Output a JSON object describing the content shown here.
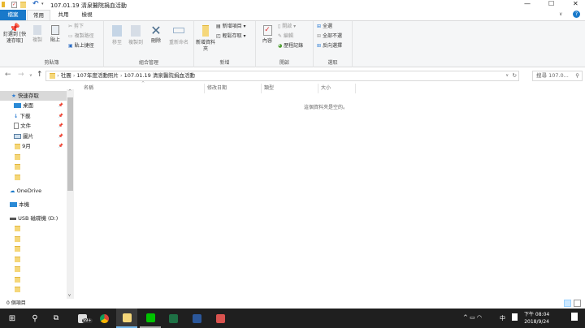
{
  "window": {
    "title": "107.01.19 清泉醫院捐血活動",
    "controls": [
      "minimize",
      "maximize",
      "close"
    ]
  },
  "tabs": [
    {
      "label": "檔案",
      "active": false,
      "file": true
    },
    {
      "label": "常用",
      "active": true
    },
    {
      "label": "共用"
    },
    {
      "label": "檢視"
    }
  ],
  "ribbon": {
    "clipboard": {
      "label": "剪貼簿",
      "pin": "釘選到 [快速存取]",
      "copy": "複製",
      "paste": "貼上",
      "cut": "剪下",
      "copy_path": "複製路徑",
      "paste_shortcut": "貼上捷徑"
    },
    "organize": {
      "label": "組合管理",
      "move_to": "移至",
      "copy_to": "複製到",
      "delete": "刪除",
      "rename": "重新命名"
    },
    "new": {
      "label": "新增",
      "new_folder": "新增資料夾",
      "new_item": "新增項目 ▾",
      "easy_access": "輕鬆存取 ▾"
    },
    "open": {
      "label": "開啟",
      "properties": "內容",
      "open": "開啟 ▾",
      "edit": "編輯",
      "history": "歷程記錄"
    },
    "select": {
      "label": "選取",
      "select_all": "全選",
      "select_none": "全部不選",
      "invert": "反向選擇"
    }
  },
  "address": {
    "path": [
      "社團",
      "107年度活動照片",
      "107.01.19 清泉醫院捐血活動"
    ],
    "search_placeholder": "搜尋 107.0..."
  },
  "sidebar": {
    "quick_access": "快速存取",
    "items": [
      {
        "label": "桌面",
        "pinned": true
      },
      {
        "label": "下載",
        "pinned": true
      },
      {
        "label": "文件",
        "pinned": true
      },
      {
        "label": "圖片",
        "pinned": true
      },
      {
        "label": "9月",
        "pinned": true
      },
      {
        "label": ""
      },
      {
        "label": ""
      },
      {
        "label": ""
      }
    ],
    "onedrive": "OneDrive",
    "this_pc": "本機",
    "usb": "USB 磁碟機 (D:)"
  },
  "columns": [
    "名稱",
    "修改日期",
    "類型",
    "大小"
  ],
  "empty_message": "這個資料夾是空的。",
  "status": "0 個項目",
  "taskbar": {
    "mail_badge": "99+",
    "ime": "中",
    "time": "下午 08:04",
    "date": "2018/9/24"
  },
  "colors": {
    "file_tab": "#1979ca",
    "taskbar": "#1f1f1f",
    "folder": "#f5d77a",
    "selected": "#cce8ff"
  }
}
